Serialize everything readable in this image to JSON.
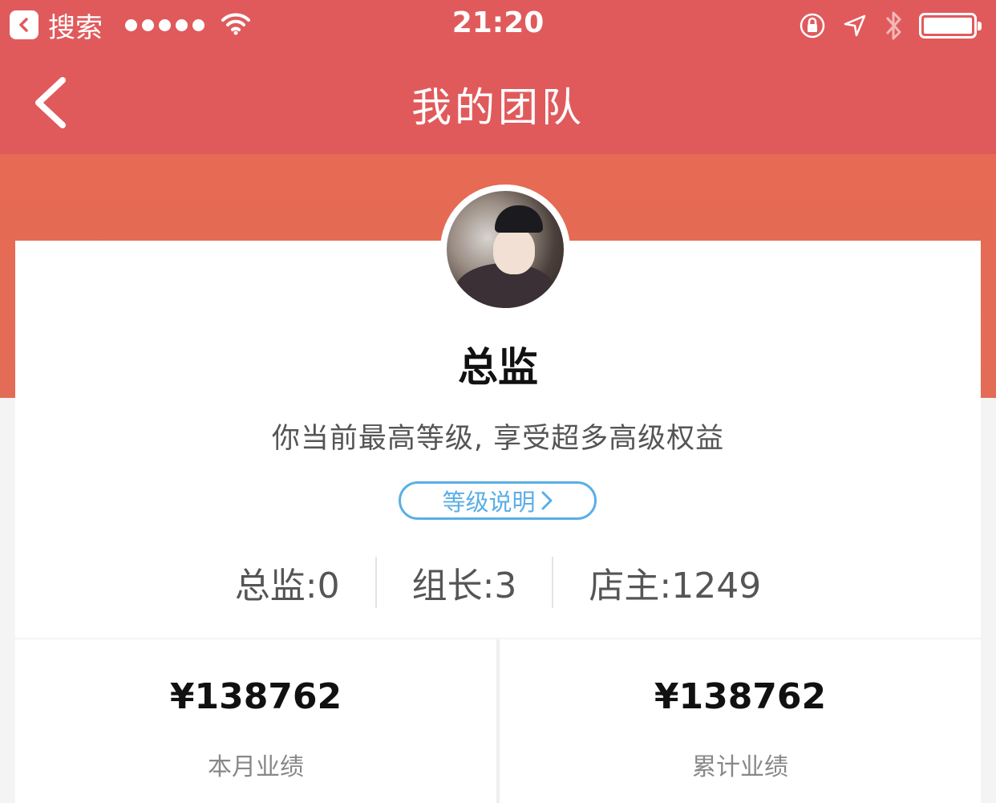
{
  "status_bar": {
    "back_app_label": "搜索",
    "time": "21:20"
  },
  "nav": {
    "title": "我的团队"
  },
  "profile": {
    "level": "总监",
    "description": "你当前最高等级, 享受超多高级权益",
    "level_button": "等级说明"
  },
  "counts": [
    {
      "label": "总监:0"
    },
    {
      "label": "组长:3"
    },
    {
      "label": "店主:1249"
    }
  ],
  "stats": [
    {
      "value": "¥138762",
      "label": "本月业绩"
    },
    {
      "value": "¥138762",
      "label": "累计业绩"
    }
  ]
}
